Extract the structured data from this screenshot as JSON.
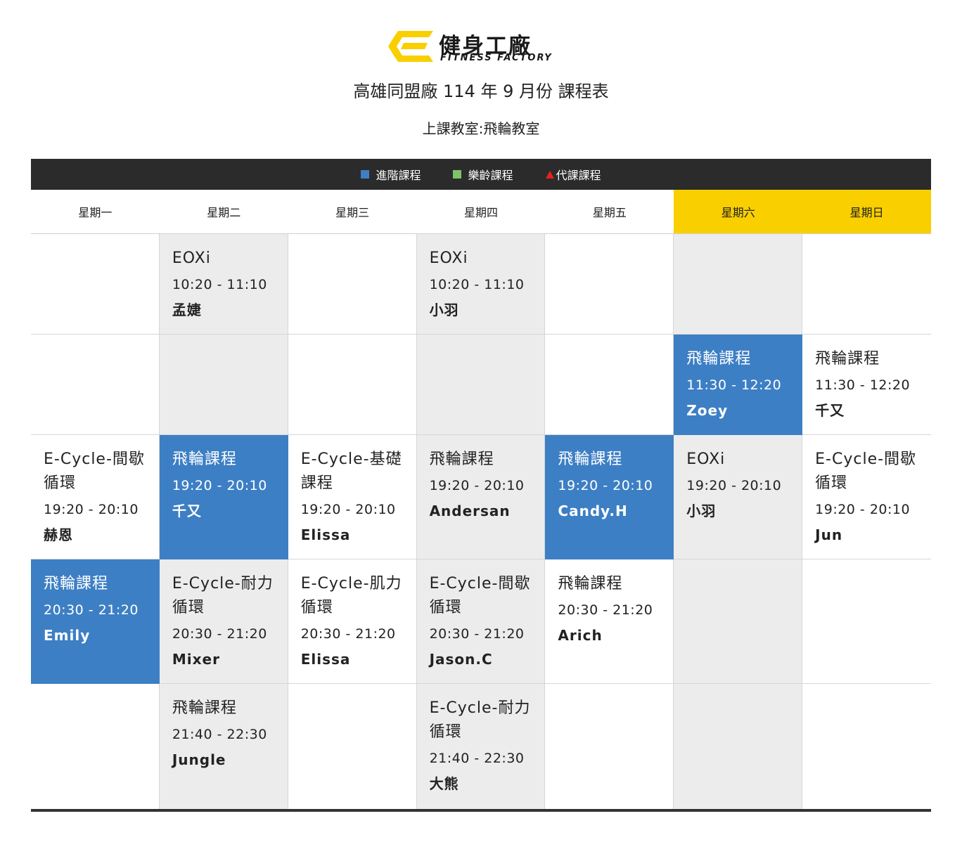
{
  "brand": {
    "name_cn": "健身工廠",
    "name_en": "FITNESS FACTORY",
    "mark_color": "#f9cf00"
  },
  "header": {
    "title": "高雄同盟廠 114 年 9 月份 課程表",
    "classroom": "上課教室:飛輪教室"
  },
  "legend": {
    "advanced": {
      "label": "進階課程",
      "color": "#3d7fc4"
    },
    "senior": {
      "label": "樂齡課程",
      "color": "#7cc46a"
    },
    "substitute": {
      "label": "代課課程",
      "color": "#e8201e"
    }
  },
  "colors": {
    "blue_cell": "#3d7fc4",
    "gray_cell": "#ececec",
    "weekend_header": "#f9cf00",
    "legend_bar": "#2b2b2b"
  },
  "days": [
    "星期一",
    "星期二",
    "星期三",
    "星期四",
    "星期五",
    "星期六",
    "星期日"
  ],
  "schedule": [
    [
      {
        "bg": "white"
      },
      {
        "bg": "gray",
        "name": "EOXi",
        "time": "10:20 - 11:10",
        "coach": "孟婕"
      },
      {
        "bg": "white"
      },
      {
        "bg": "gray",
        "name": "EOXi",
        "time": "10:20 - 11:10",
        "coach": "小羽"
      },
      {
        "bg": "white"
      },
      {
        "bg": "gray"
      },
      {
        "bg": "white"
      }
    ],
    [
      {
        "bg": "white"
      },
      {
        "bg": "gray"
      },
      {
        "bg": "white"
      },
      {
        "bg": "gray"
      },
      {
        "bg": "white"
      },
      {
        "bg": "blue",
        "name": "飛輪課程",
        "time": "11:30 - 12:20",
        "coach": "Zoey"
      },
      {
        "bg": "white",
        "name": "飛輪課程",
        "time": "11:30 - 12:20",
        "coach": "千又"
      }
    ],
    [
      {
        "bg": "white",
        "name": "E-Cycle-間歇循環",
        "time": "19:20 - 20:10",
        "coach": "赫恩"
      },
      {
        "bg": "blue",
        "name": "飛輪課程",
        "time": "19:20 - 20:10",
        "coach": "千又"
      },
      {
        "bg": "white",
        "name": "E-Cycle-基礎課程",
        "time": "19:20 - 20:10",
        "coach": "Elissa"
      },
      {
        "bg": "gray",
        "name": "飛輪課程",
        "time": "19:20 - 20:10",
        "coach": "Andersan"
      },
      {
        "bg": "blue",
        "name": "飛輪課程",
        "time": "19:20 - 20:10",
        "coach": "Candy.H"
      },
      {
        "bg": "gray",
        "name": "EOXi",
        "time": "19:20 - 20:10",
        "coach": "小羽"
      },
      {
        "bg": "white",
        "name": "E-Cycle-間歇循環",
        "time": "19:20 - 20:10",
        "coach": "Jun"
      }
    ],
    [
      {
        "bg": "blue",
        "name": "飛輪課程",
        "time": "20:30 - 21:20",
        "coach": "Emily"
      },
      {
        "bg": "gray",
        "name": "E-Cycle-耐力循環",
        "time": "20:30 - 21:20",
        "coach": "Mixer"
      },
      {
        "bg": "white",
        "name": "E-Cycle-肌力循環",
        "time": "20:30 - 21:20",
        "coach": "Elissa"
      },
      {
        "bg": "gray",
        "name": "E-Cycle-間歇循環",
        "time": "20:30 - 21:20",
        "coach": "Jason.C"
      },
      {
        "bg": "white",
        "name": "飛輪課程",
        "time": "20:30 - 21:20",
        "coach": "Arich"
      },
      {
        "bg": "gray"
      },
      {
        "bg": "white"
      }
    ],
    [
      {
        "bg": "white"
      },
      {
        "bg": "gray",
        "name": "飛輪課程",
        "time": "21:40 - 22:30",
        "coach": "Jungle"
      },
      {
        "bg": "white"
      },
      {
        "bg": "gray",
        "name": "E-Cycle-耐力循環",
        "time": "21:40 - 22:30",
        "coach": "大熊"
      },
      {
        "bg": "white"
      },
      {
        "bg": "gray"
      },
      {
        "bg": "white"
      }
    ]
  ]
}
